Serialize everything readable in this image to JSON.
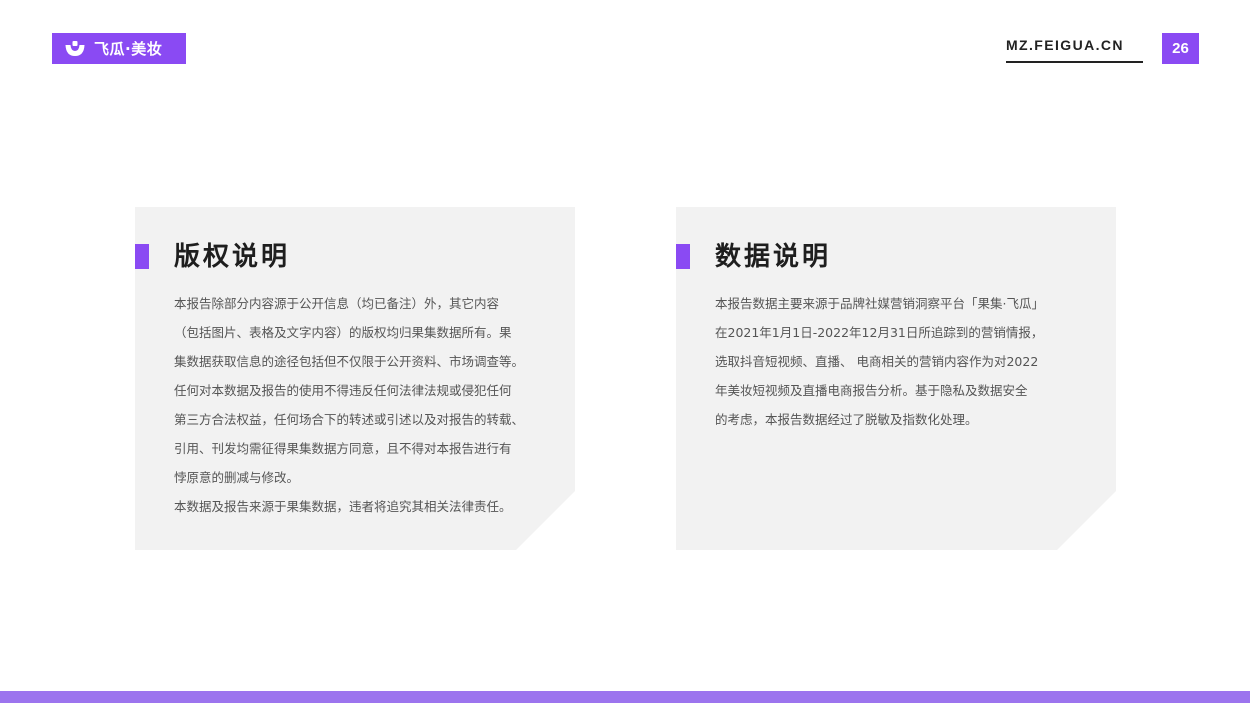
{
  "brand": {
    "logo_text": "飞瓜·美妆",
    "logo_icon": "feigua-smile-icon",
    "accent_color": "#8a4af3"
  },
  "header": {
    "site_url": "MZ.FEIGUA.CN",
    "page_number": "26"
  },
  "cards": [
    {
      "title": "版权说明",
      "lines": [
        "本报告除部分内容源于公开信息（均已备注）外，其它内容",
        "（包括图片、表格及文字内容）的版权均归果集数据所有。果",
        "集数据获取信息的途径包括但不仅限于公开资料、市场调查等。",
        "任何对本数据及报告的使用不得违反任何法律法规或侵犯任何",
        "第三方合法权益，任何场合下的转述或引述以及对报告的转载、",
        "引用、刊发均需征得果集数据方同意，且不得对本报告进行有",
        "悖原意的删减与修改。",
        "本数据及报告来源于果集数据，违者将追究其相关法律责任。"
      ]
    },
    {
      "title": "数据说明",
      "lines": [
        "本报告数据主要来源于品牌社媒营销洞察平台「果集·飞瓜」",
        "在2021年1月1日-2022年12月31日所追踪到的营销情报，",
        "选取抖音短视频、直播、 电商相关的营销内容作为对2022",
        "年美妆短视频及直播电商报告分析。基于隐私及数据安全",
        "的考虑，本报告数据经过了脱敏及指数化处理。"
      ]
    }
  ]
}
